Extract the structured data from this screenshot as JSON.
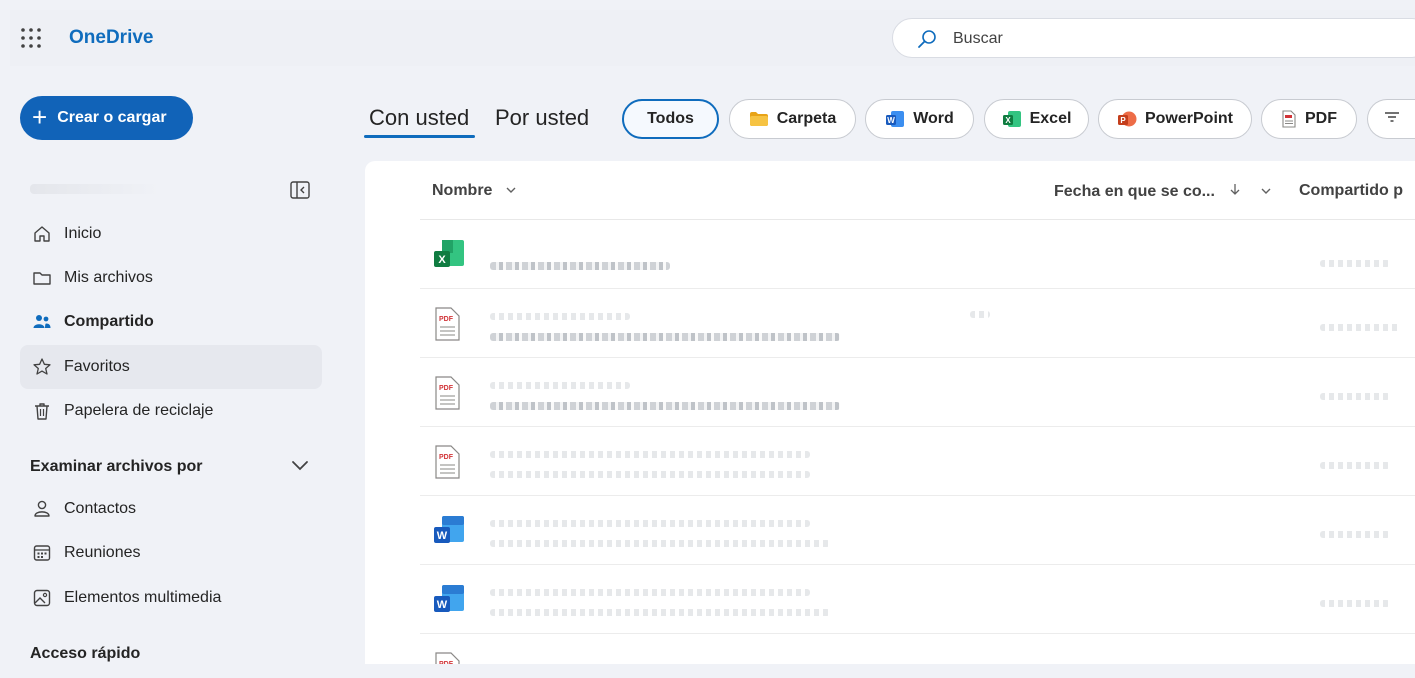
{
  "app": {
    "title": "OneDrive"
  },
  "search": {
    "placeholder": "Buscar"
  },
  "sidebar": {
    "create_label": "Crear o cargar",
    "items": [
      {
        "label": "Inicio",
        "icon": "home-icon"
      },
      {
        "label": "Mis archivos",
        "icon": "folder-icon"
      },
      {
        "label": "Compartido",
        "icon": "people-icon"
      },
      {
        "label": "Favoritos",
        "icon": "star-icon"
      },
      {
        "label": "Papelera de reciclaje",
        "icon": "trash-icon"
      }
    ],
    "browse_section": "Examinar archivos por",
    "browse_items": [
      {
        "label": "Contactos",
        "icon": "person-icon"
      },
      {
        "label": "Reuniones",
        "icon": "calendar-icon"
      },
      {
        "label": "Elementos multimedia",
        "icon": "image-icon"
      }
    ],
    "quick_access": "Acceso rápido"
  },
  "tabs": [
    {
      "label": "Con usted"
    },
    {
      "label": "Por usted"
    }
  ],
  "filters": [
    {
      "label": "Todos"
    },
    {
      "label": "Carpeta"
    },
    {
      "label": "Word"
    },
    {
      "label": "Excel"
    },
    {
      "label": "PowerPoint"
    },
    {
      "label": "PDF"
    }
  ],
  "table": {
    "columns": [
      {
        "label": "Nombre"
      },
      {
        "label": "Fecha en que se co..."
      },
      {
        "label": "Compartido p"
      }
    ]
  },
  "colors": {
    "accent": "#0f6cbd",
    "create_button": "#1163b8",
    "excel": "#107c41",
    "word": "#185abd",
    "powerpoint": "#c43e1c",
    "pdf": "#d13438"
  }
}
